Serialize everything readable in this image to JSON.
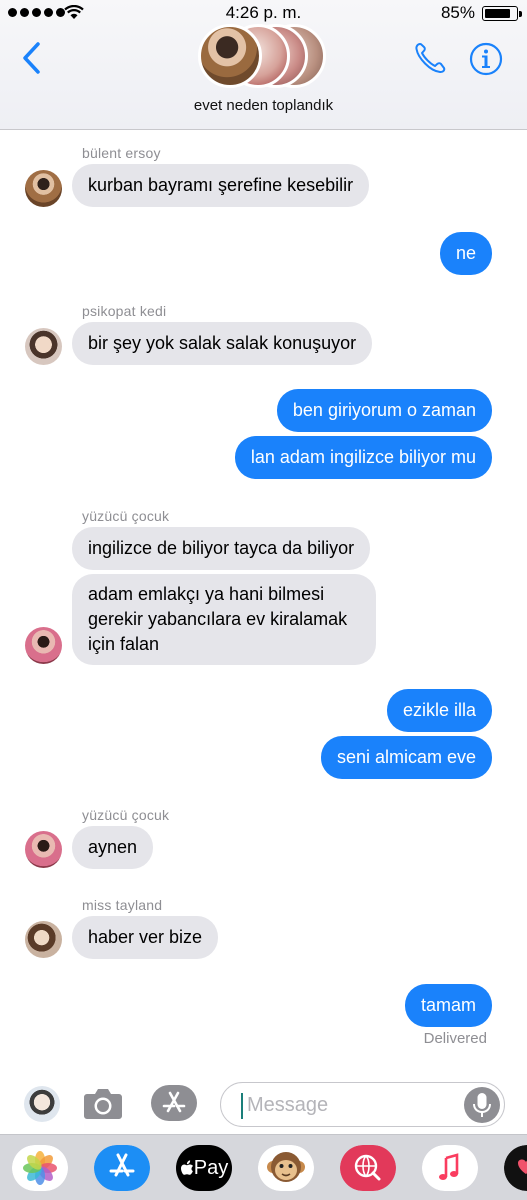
{
  "status_bar": {
    "time": "4:26 p. m.",
    "battery": "85%",
    "battery_level": 0.85
  },
  "header": {
    "group_name": "evet neden toplandık"
  },
  "messages": [
    {
      "sender": "bülent ersoy",
      "text": "kurban bayramı şerefine kesebilir",
      "direction": "incoming"
    },
    {
      "text": "ne",
      "direction": "outgoing"
    },
    {
      "sender": "psikopat kedi",
      "text": "bir şey yok salak salak konuşuyor",
      "direction": "incoming"
    },
    {
      "text": "ben giriyorum o zaman",
      "direction": "outgoing"
    },
    {
      "text": "lan adam ingilizce biliyor mu",
      "direction": "outgoing"
    },
    {
      "sender": "yüzücü çocuk",
      "text": "ingilizce de biliyor tayca da biliyor",
      "direction": "incoming"
    },
    {
      "text": "adam emlakçı ya hani bilmesi gerekir yabancılara ev kiralamak için falan",
      "direction": "incoming"
    },
    {
      "text": "ezikle illa",
      "direction": "outgoing"
    },
    {
      "text": "seni almicam eve",
      "direction": "outgoing"
    },
    {
      "sender": "yüzücü çocuk",
      "text": "aynen",
      "direction": "incoming"
    },
    {
      "sender": "miss tayland",
      "text": "haber ver bize",
      "direction": "incoming"
    },
    {
      "text": "tamam",
      "direction": "outgoing"
    }
  ],
  "delivery_status": "Delivered",
  "input": {
    "placeholder": "Message"
  },
  "icons": {
    "back": "chevron-left-icon",
    "phone": "phone-icon",
    "info": "info-icon",
    "camera": "camera-icon",
    "apps": "app-store-icon",
    "mic": "microphone-icon"
  },
  "app_drawer": {
    "apple_pay_label": "Pay",
    "apps": [
      "photos",
      "app-store",
      "apple-pay",
      "animoji",
      "web-images",
      "music",
      "digital-touch"
    ]
  },
  "colors": {
    "accent": "#1a82fb",
    "incoming_bubble": "#e5e5ea",
    "secondary_text": "#8e8e93"
  }
}
